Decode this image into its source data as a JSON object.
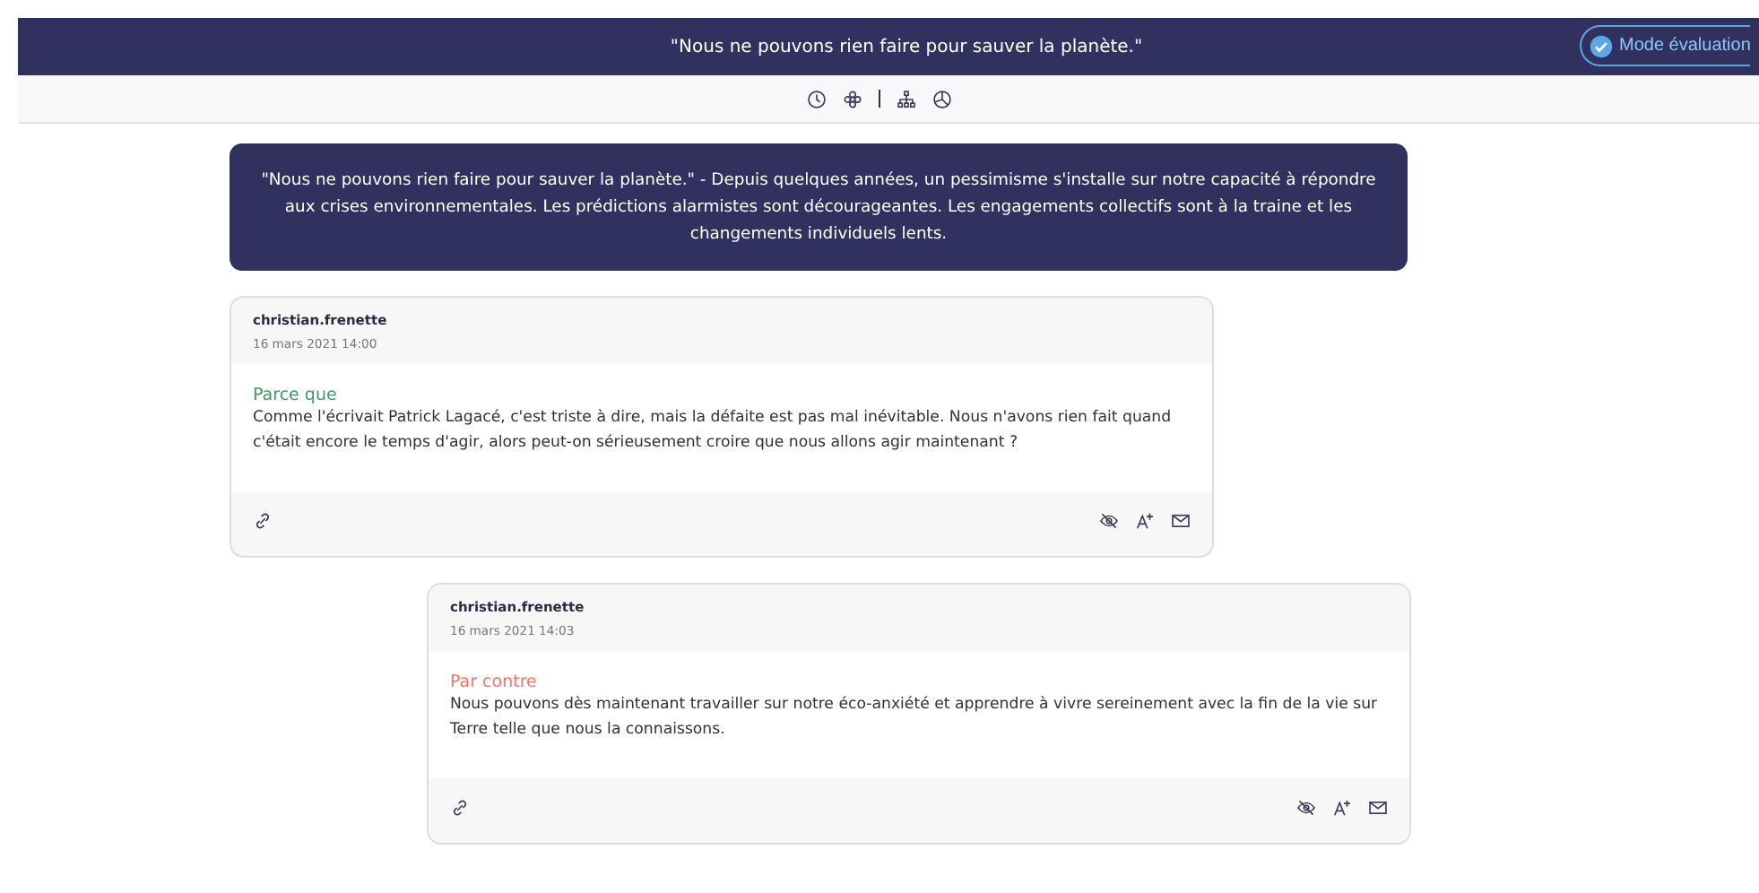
{
  "header": {
    "title": "\"Nous ne pouvons rien faire pour sauver la planète.\"",
    "mode_button": "Mode évaluation"
  },
  "statement": "\"Nous ne pouvons rien faire pour sauver la planète.\" - Depuis quelques années, un pessimisme s'installe sur notre capacité à répondre aux crises environnementales. Les prédictions alarmistes sont décourageantes. Les engagements collectifs sont à la traine et les changements individuels lents.",
  "arguments": [
    {
      "author": "christian.frenette",
      "date": "16 mars 2021 14:00",
      "label": "Parce que",
      "color": "#3f9a63",
      "text": "Comme l'écrivait Patrick Lagacé, c'est triste à dire, mais la défaite est pas mal inévitable. Nous n'avons rien fait quand c'était encore le temps d'agir, alors peut-on sérieusement croire que nous allons agir maintenant ?",
      "children": [
        {
          "author": "christian.frenette",
          "date": "16 mars 2021 14:03",
          "label": "Par contre",
          "color": "#f0786a",
          "text": "Nous pouvons dès maintenant travailler sur notre éco-anxiété et apprendre à vivre sereinement avec la fin de la vie sur Terre telle que nous la connaissons."
        }
      ]
    }
  ]
}
